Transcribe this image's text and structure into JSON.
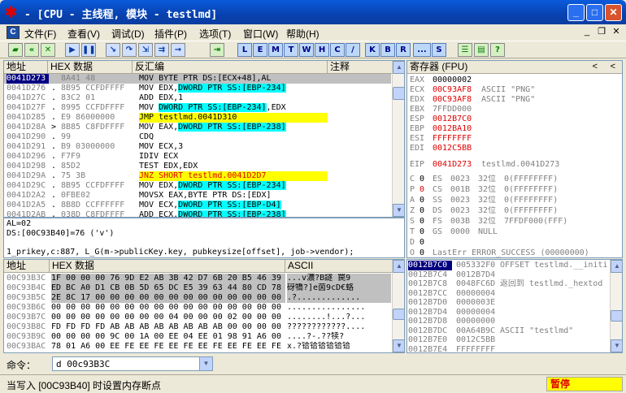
{
  "window": {
    "title": "- [CPU - 主线程, 模块 - testlmd]"
  },
  "menu": {
    "items": [
      "文件(F)",
      "查看(V)",
      "调试(D)",
      "插件(P)",
      "选项(T)",
      "窗口(W)",
      "帮助(H)"
    ]
  },
  "toolbar": {
    "letters": [
      "L",
      "E",
      "M",
      "T",
      "W",
      "H",
      "C",
      "/",
      "K",
      "B",
      "R",
      "...",
      "S"
    ]
  },
  "disasm": {
    "headers": {
      "address": "地址",
      "hex": "HEX 数据",
      "asm": "反汇编",
      "comment": "注释"
    },
    "rows": [
      {
        "addr": "0041D273",
        "m": "",
        "hex": "8A41 48",
        "asm": "MOV BYTE PTR DS:[ECX+48],AL"
      },
      {
        "addr": "0041D276",
        "m": ".",
        "hex": "8B95 CCFDFFFF",
        "asm": "MOV EDX,DWORD PTR SS:[EBP-234]"
      },
      {
        "addr": "0041D27C",
        "m": ".",
        "hex": "83C2 01",
        "asm": "ADD EDX,1"
      },
      {
        "addr": "0041D27F",
        "m": ".",
        "hex": "8995 CCFDFFFF",
        "asm": "MOV DWORD PTR SS:[EBP-234],EDX"
      },
      {
        "addr": "0041D285",
        "m": ".",
        "hex": "E9 86000000",
        "asm": "JMP testlmd.0041D310"
      },
      {
        "addr": "0041D28A",
        "m": ">",
        "hex": "8B85 C8FDFFFF",
        "asm": "MOV EAX,DWORD PTR SS:[EBP-238]"
      },
      {
        "addr": "0041D290",
        "m": ".",
        "hex": "99",
        "asm": "CDQ"
      },
      {
        "addr": "0041D291",
        "m": ".",
        "hex": "B9 03000000",
        "asm": "MOV ECX,3"
      },
      {
        "addr": "0041D296",
        "m": ".",
        "hex": "F7F9",
        "asm": "IDIV ECX"
      },
      {
        "addr": "0041D298",
        "m": ".",
        "hex": "85D2",
        "asm": "TEST EDX,EDX"
      },
      {
        "addr": "0041D29A",
        "m": ".",
        "hex": "75 3B",
        "asm": "JNZ SHORT testlmd.0041D2D7"
      },
      {
        "addr": "0041D29C",
        "m": ".",
        "hex": "8B95 CCFDFFFF",
        "asm": "MOV EDX,DWORD PTR SS:[EBP-234]"
      },
      {
        "addr": "0041D2A2",
        "m": ".",
        "hex": "0FBE02",
        "asm": "MOVSX EAX,BYTE PTR DS:[EDX]"
      },
      {
        "addr": "0041D2A5",
        "m": ".",
        "hex": "8B8D CCFFFFFF",
        "asm": "MOV ECX,DWORD PTR SS:[EBP-D4]"
      },
      {
        "addr": "0041D2AB",
        "m": ".",
        "hex": "038D C8FDFFFF",
        "asm": "ADD ECX,DWORD PTR SS:[EBP-238]"
      }
    ]
  },
  "info": {
    "line1": "AL=02",
    "line2": "DS:[00C93B40]=76 ('v')",
    "line3": "1_prikey,c:887,   L_G(m->publicKey.key, pubkeysize[offset], job->vendor);"
  },
  "registers": {
    "header": "寄存器 (FPU)",
    "regs": [
      {
        "name": "EAX",
        "val": "00000002",
        "note": ""
      },
      {
        "name": "ECX",
        "val": "00C93AF8",
        "note": "ASCII \"PNG\""
      },
      {
        "name": "EDX",
        "val": "00C93AF8",
        "note": "ASCII \"PNG\""
      },
      {
        "name": "EBX",
        "val": "7FFDD000",
        "note": ""
      },
      {
        "name": "ESP",
        "val": "0012B7C0",
        "note": ""
      },
      {
        "name": "EBP",
        "val": "0012BA10",
        "note": ""
      },
      {
        "name": "ESI",
        "val": "FFFFFFFF",
        "note": ""
      },
      {
        "name": "EDI",
        "val": "0012C5BB",
        "note": ""
      }
    ],
    "eip": {
      "name": "EIP",
      "val": "0041D273",
      "note": "testlmd.0041D273"
    },
    "flags": [
      {
        "f": "C",
        "v": "0",
        "seg": "ES",
        "sel": "0023",
        "bits": "32位",
        "base": "0(FFFFFFFF)"
      },
      {
        "f": "P",
        "v": "0",
        "seg": "CS",
        "sel": "001B",
        "bits": "32位",
        "base": "0(FFFFFFFF)"
      },
      {
        "f": "A",
        "v": "0",
        "seg": "SS",
        "sel": "0023",
        "bits": "32位",
        "base": "0(FFFFFFFF)"
      },
      {
        "f": "Z",
        "v": "0",
        "seg": "DS",
        "sel": "0023",
        "bits": "32位",
        "base": "0(FFFFFFFF)"
      },
      {
        "f": "S",
        "v": "0",
        "seg": "FS",
        "sel": "003B",
        "bits": "32位",
        "base": "7FFDF000(FFF)"
      },
      {
        "f": "T",
        "v": "0",
        "seg": "GS",
        "sel": "0000",
        "bits": "NULL",
        "base": ""
      }
    ],
    "dflag": {
      "f": "D",
      "v": "0"
    },
    "oflag": {
      "f": "O",
      "v": "0",
      "text": "LastErr ERROR_SUCCESS (00000000)"
    },
    "efl": "EFL 00000202 (NO,NB,NE,A,NS,PO,GE,G)"
  },
  "dump": {
    "headers": {
      "address": "地址",
      "hex": "HEX 数据",
      "ascii": "ASCII"
    },
    "rows": [
      {
        "addr": "00C93B3C",
        "hex": "1F 00 00 00 76 9D E2 AB 3B 42 D7 6B 20 B5 46 39",
        "ascii": "...v濃?B譢 罠9"
      },
      {
        "addr": "00C93B4C",
        "hex": "ED BC A0 D1 CB 0B 5D 65 DC E5 39 63 44 80 CD 78",
        "ascii": "砑犞?]e茵9cD€蛒"
      },
      {
        "addr": "00C93B5C",
        "hex": "2E 8C 17 00 00 00 00 00 00 00 00 00 00 00 00 00",
        "ascii": ".?............."
      },
      {
        "addr": "00C93B6C",
        "hex": "00 00 00 00 00 00 00 00 00 00 00 00 00 00 00 00",
        "ascii": "................"
      },
      {
        "addr": "00C93B7C",
        "hex": "00 00 00 00 00 00 00 00 04 00 00 00 02 00 00 00",
        "ascii": "........!...?..."
      },
      {
        "addr": "00C93B8C",
        "hex": "FD FD FD FD AB AB AB AB AB AB AB AB 00 00 00 00",
        "ascii": "????????????...."
      },
      {
        "addr": "00C93B9C",
        "hex": "00 00 00 00 9C 00 1A 00 EE 04 EE 01 98 91 A6 00",
        "ascii": "....?-.??犊?"
      },
      {
        "addr": "00C93BAC",
        "hex": "78 01 A6 00 EE FE EE FE EE FE EE FE EE FE EE FE",
        "ascii": "x.?铪铪铪铪铪铪"
      }
    ]
  },
  "stack": {
    "rows": [
      {
        "addr": "0012B7C0",
        "val": "005332F0",
        "note": "OFFSET testlmd.__initi"
      },
      {
        "addr": "0012B7C4",
        "val": "0012B7D4",
        "note": ""
      },
      {
        "addr": "0012B7C8",
        "val": "0048FC6D",
        "note": "返回到 testlmd._hextod"
      },
      {
        "addr": "0012B7CC",
        "val": "00000004",
        "note": ""
      },
      {
        "addr": "0012B7D0",
        "val": "0000003E",
        "note": ""
      },
      {
        "addr": "0012B7D4",
        "val": "00000004",
        "note": ""
      },
      {
        "addr": "0012B7D8",
        "val": "00000000",
        "note": ""
      },
      {
        "addr": "0012B7DC",
        "val": "00A64B9C",
        "note": "ASCII \"testlmd\""
      },
      {
        "addr": "0012B7E0",
        "val": "0012C5BB",
        "note": ""
      },
      {
        "addr": "0012B7E4",
        "val": "FFFFFFFF",
        "note": ""
      }
    ]
  },
  "command": {
    "label": "命令：",
    "value": "d 00c93B3C"
  },
  "status": {
    "text": "当写入 [00C93B40] 时设置内存断点",
    "state": "暂停"
  }
}
